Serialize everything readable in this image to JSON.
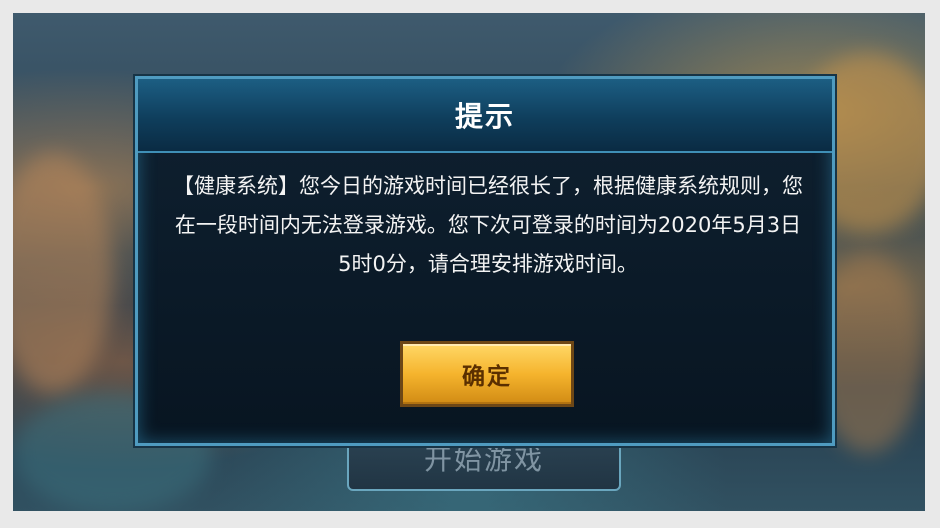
{
  "background": {
    "start_game_label": "开始游戏"
  },
  "dialog": {
    "title": "提示",
    "message": "【健康系统】您今日的游戏时间已经很长了，根据健康系统规则，您在一段时间内无法登录游戏。您下次可登录的时间为2020年5月3日5时0分，请合理安排游戏时间。",
    "confirm_label": "确定"
  },
  "colors": {
    "dialog_border": "#4f9bc0",
    "dialog_background": "#0b1927",
    "button_gold": "#f5b42d",
    "button_border": "#6d4716"
  }
}
